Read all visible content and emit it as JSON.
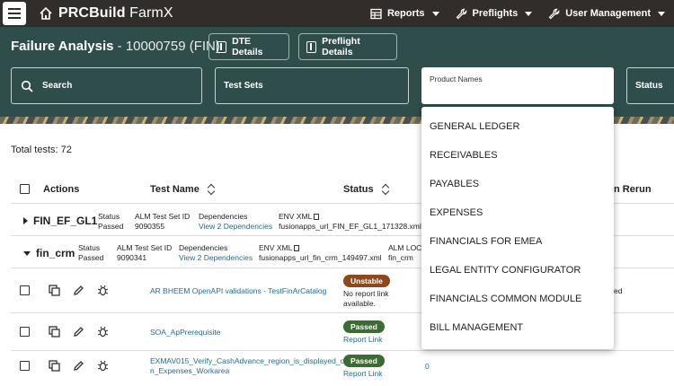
{
  "topbar": {
    "brand_bold": "PRCBuild",
    "brand_thin": " FarmX",
    "nav": [
      {
        "label": "Reports",
        "icon": "table-icon"
      },
      {
        "label": "Preflights",
        "icon": "wrench-icon"
      },
      {
        "label": "User Management",
        "icon": "wrench-icon"
      }
    ]
  },
  "header": {
    "title": "Failure Analysis",
    "title_id": " - 10000759 (FIN)",
    "buttons": [
      "DTE Details",
      "Preflight Details"
    ],
    "filters": {
      "search": "Search",
      "test_sets": "Test Sets",
      "product_names": "Product Names",
      "status": "Status"
    }
  },
  "main": {
    "total_tests": "Total tests: 72",
    "columns": {
      "actions": "Actions",
      "test_name": "Test Name",
      "status": "Status",
      "rerun_partial": "n Rerun"
    },
    "groups": [
      {
        "name": "FIN_EF_GL1",
        "status_label": "Status",
        "status_value": "Passed",
        "alm_label": "ALM Test Set ID",
        "alm_value": "9090355",
        "dep_label": "Dependencies",
        "dep_link": "View 2 Dependencies",
        "env_label": "ENV XML",
        "env_value": "fusionapps_url_FIN_EF_GL1_171328.xml"
      },
      {
        "name": "fin_crm",
        "status_label": "Status",
        "status_value": "Passed",
        "alm_label": "ALM Test Set ID",
        "alm_value": "9090341",
        "dep_label": "Dependencies",
        "dep_link": "View 2 Dependencies",
        "env_label": "ENV XML",
        "env_value": "fusionapps_url_fin_crm_149497.xml",
        "alm_loc_label": "ALM LOC",
        "alm_loc_value": "fin_crm"
      }
    ],
    "rows": [
      {
        "test_name": "AR BHEEM OpenAPI validations - TestFinArCatalog",
        "status_badge": "Unstable",
        "status_note": "No report link available.",
        "extra": "ed"
      },
      {
        "test_name": "SOA_ApPrerequisite",
        "status_badge": "Passed",
        "status_note": "Report Link"
      },
      {
        "test_name_line1": "EXMAV015_Verify_CashAdvance_region_is_displayed_o",
        "test_name_line2": "n_Expenses_Workarea",
        "status_badge": "Passed",
        "status_note": "Report Link",
        "extra": "0"
      }
    ]
  },
  "dropdown": {
    "items": [
      "GENERAL LEDGER",
      "RECEIVABLES",
      "PAYABLES",
      "EXPENSES",
      "FINANCIALS FOR EMEA",
      "LEGAL ENTITY CONFIGURATOR",
      "FINANCIALS COMMON MODULE",
      "BILL MANAGEMENT"
    ]
  },
  "colors": {
    "topbar": "#312d2a",
    "header_band": "#2f4d4b",
    "link": "#1f6d8c",
    "badge_unstable": "#8b4a1c",
    "badge_passed": "#3d6b34"
  }
}
